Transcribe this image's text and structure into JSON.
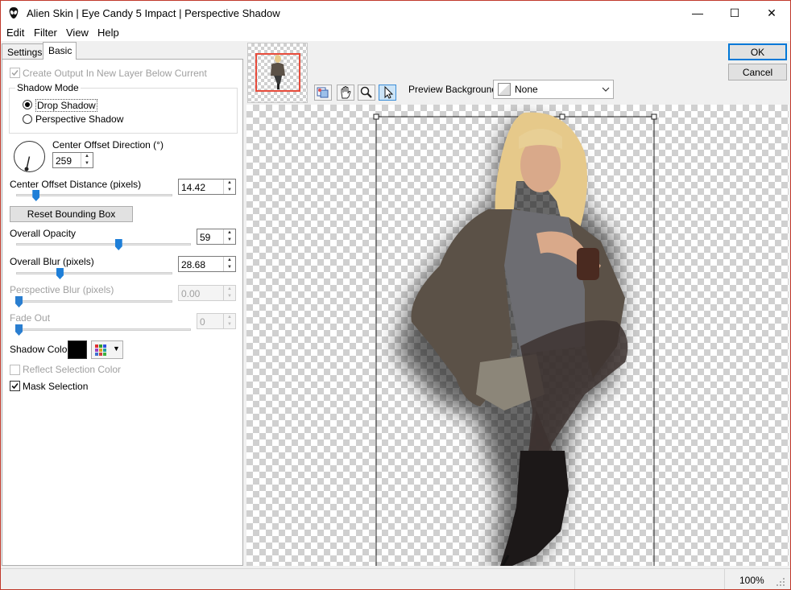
{
  "window": {
    "title": "Alien Skin | Eye Candy 5 Impact | Perspective Shadow",
    "minimize_glyph": "—",
    "maximize_glyph": "☐",
    "close_glyph": "✕"
  },
  "menu": {
    "items": [
      "Edit",
      "Filter",
      "View",
      "Help"
    ]
  },
  "tabs": [
    "Settings",
    "Basic"
  ],
  "basic": {
    "create_output_label": "Create Output In New Layer Below Current",
    "create_output_checked": true,
    "shadow_mode_label": "Shadow Mode",
    "shadow_mode_options": [
      "Drop Shadow",
      "Perspective Shadow"
    ],
    "shadow_mode_selected": "Drop Shadow",
    "center_offset_direction_label": "Center Offset Direction (°)",
    "center_offset_direction_value": "259",
    "center_offset_distance_label": "Center Offset Distance (pixels)",
    "center_offset_distance_value": "14.42",
    "reset_bounding_box_label": "Reset Bounding Box",
    "overall_opacity_label": "Overall Opacity",
    "overall_opacity_value": "59",
    "overall_blur_label": "Overall Blur (pixels)",
    "overall_blur_value": "28.68",
    "perspective_blur_label": "Perspective Blur (pixels)",
    "perspective_blur_value": "0.00",
    "fade_out_label": "Fade Out",
    "fade_out_value": "0",
    "shadow_color_label": "Shadow Color",
    "shadow_color": "#000000",
    "reflect_selection_color_label": "Reflect Selection Color",
    "reflect_selection_color_checked": false,
    "mask_selection_label": "Mask Selection",
    "mask_selection_checked": true
  },
  "sliders": {
    "distance_fraction": 0.09,
    "opacity_fraction": 0.59,
    "blur_fraction": 0.27,
    "perspective_blur_fraction": 0.0,
    "fade_out_fraction": 0.0
  },
  "buttons": {
    "ok_label": "OK",
    "cancel_label": "Cancel"
  },
  "preview": {
    "background_label": "Preview Background:",
    "background_value": "None",
    "zoom": "100%"
  },
  "colors": {
    "accent": "#0078d7",
    "slider_thumb": "#1e7fd8",
    "nav_frame": "#e74c3c"
  }
}
